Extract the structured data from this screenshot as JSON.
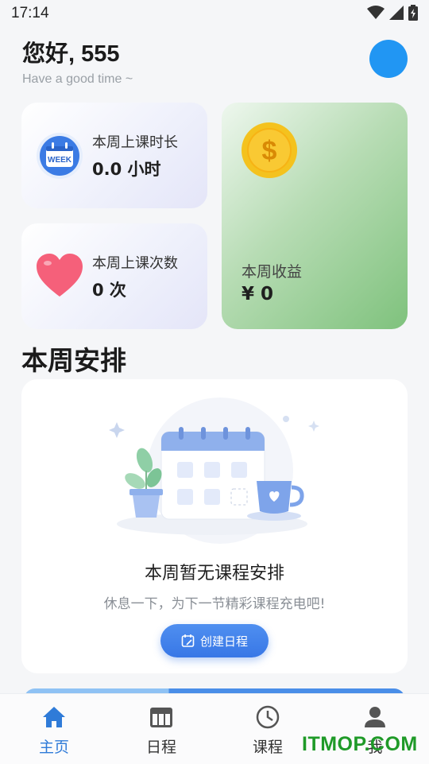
{
  "status_bar": {
    "time": "17:14",
    "icons": [
      "wifi-icon",
      "signal-icon",
      "battery-icon"
    ]
  },
  "header": {
    "greeting": "您好, 555",
    "subtitle": "Have a good time ~"
  },
  "stats": {
    "duration": {
      "label": "本周上课时长",
      "value": "0.0 小时",
      "icon_text": "WEEK"
    },
    "count": {
      "label": "本周上课次数",
      "value": "0 次"
    },
    "income": {
      "label": "本周收益",
      "value": "¥ 0"
    }
  },
  "schedule": {
    "title": "本周安排",
    "empty_title": "本周暂无课程安排",
    "empty_subtitle": "休息一下，为下一节精彩课程充电吧!",
    "button_label": "创建日程"
  },
  "nav": {
    "items": [
      {
        "label": "主页",
        "icon": "home-icon",
        "active": true
      },
      {
        "label": "日程",
        "icon": "calendar-icon",
        "active": false
      },
      {
        "label": "课程",
        "icon": "clock-icon",
        "active": false
      },
      {
        "label": "我",
        "icon": "person-icon",
        "active": false
      }
    ]
  },
  "watermark": "ITMOP.COM",
  "colors": {
    "accent": "#2f7bd8",
    "avatar": "#2196f3",
    "income_green": "#7fc27d",
    "button_blue": "#3877e6"
  }
}
